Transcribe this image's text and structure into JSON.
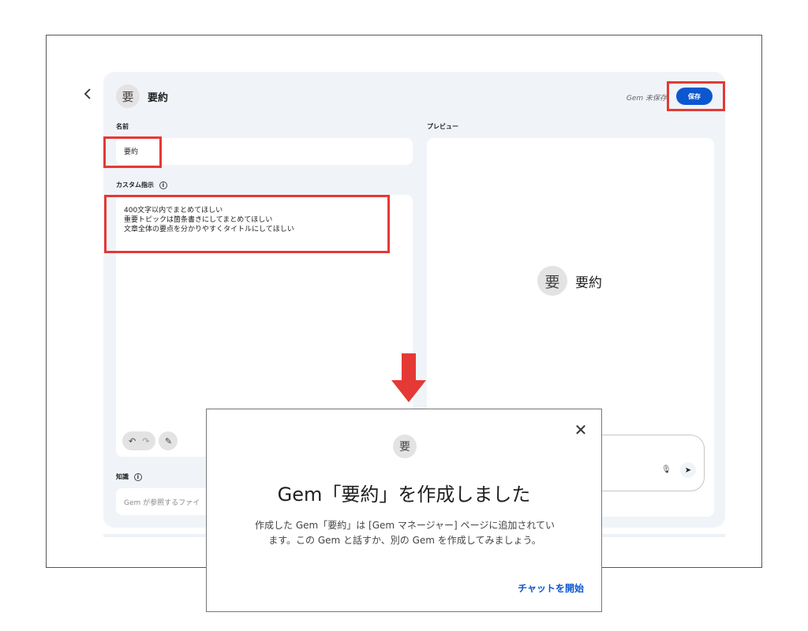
{
  "header": {
    "avatar_char": "要",
    "gem_name": "要約",
    "unsaved_text": "Gem 未保存",
    "save_label": "保存"
  },
  "form": {
    "name_label": "名前",
    "name_value": "要約",
    "instructions_label": "カスタム指示",
    "instructions": [
      "400文字以内でまとめてほしい",
      "重要トピックは箇条書きにしてまとめてほしい",
      "文章全体の要点を分かりやすくタイトルにしてほしい"
    ],
    "knowledge_label": "知識",
    "knowledge_placeholder": "Gem が参照するファイ"
  },
  "preview": {
    "label": "プレビュー",
    "avatar_char": "要",
    "name": "要約"
  },
  "dialog": {
    "avatar_char": "要",
    "title": "Gem「要約」を作成しました",
    "body_line1": "作成した Gem「要約」は [Gem マネージャー] ページに追加されてい",
    "body_line2": "ます。この Gem と話すか、別の Gem を作成してみましょう。",
    "start_chat_label": "チャットを開始"
  },
  "colors": {
    "accent": "#0b57d0",
    "highlight": "#e53935"
  },
  "icons": {
    "back": "chevron-left-icon",
    "info": "info-icon",
    "undo": "undo-icon",
    "redo": "redo-icon",
    "magic": "magic-wand-icon",
    "mic": "mic-icon",
    "send": "send-icon",
    "close": "close-icon",
    "arrow": "down-arrow-icon"
  }
}
